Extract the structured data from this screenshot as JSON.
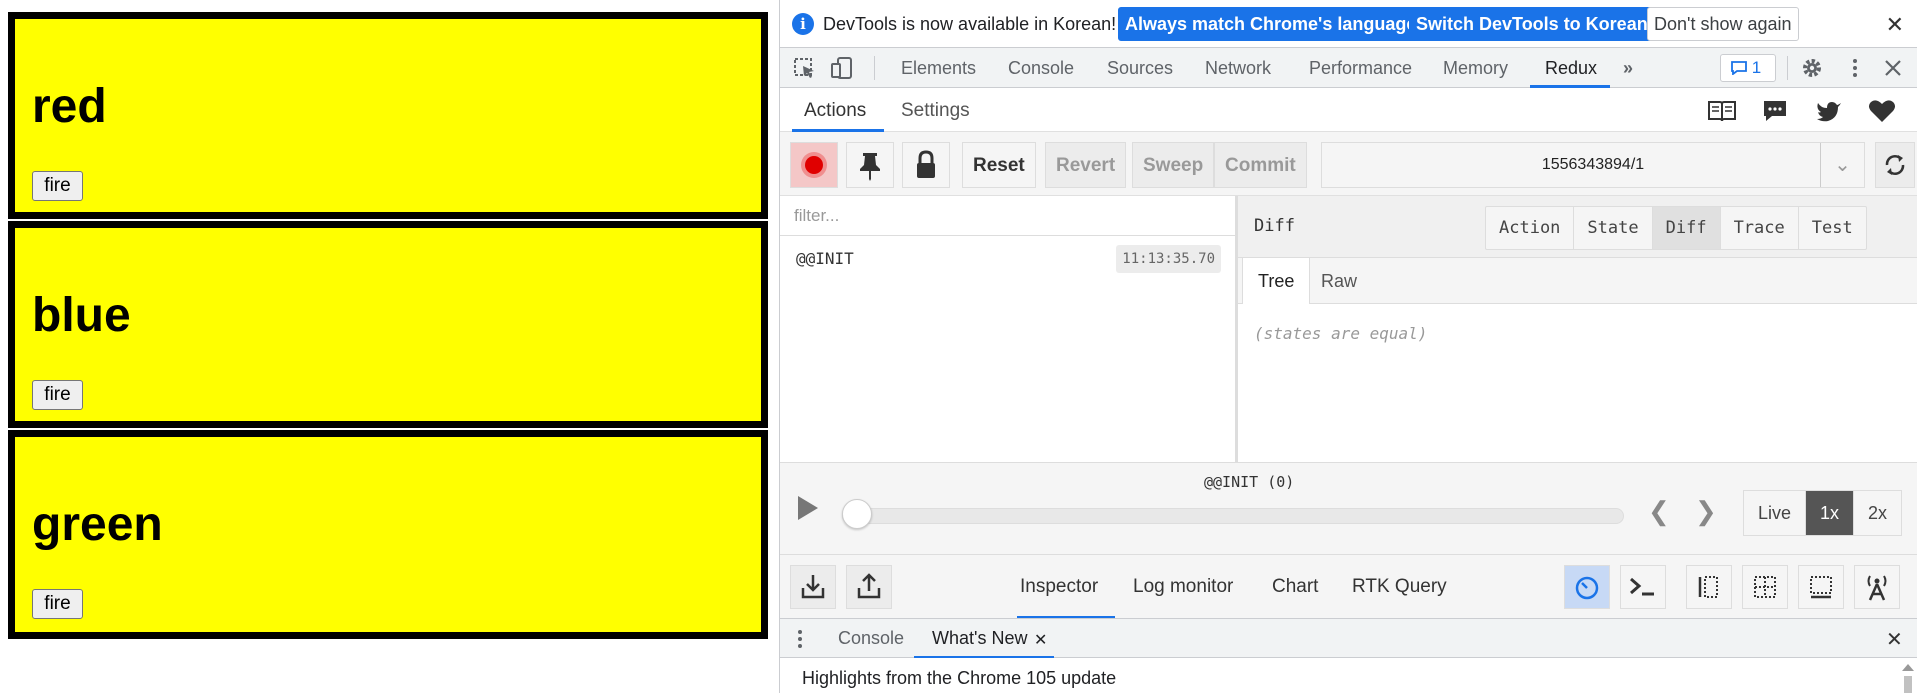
{
  "page": {
    "boxes": [
      {
        "heading": "red",
        "button": "fire"
      },
      {
        "heading": "blue",
        "button": "fire"
      },
      {
        "heading": "green",
        "button": "fire"
      }
    ]
  },
  "devtools": {
    "infobar": {
      "message": "DevTools is now available in Korean!",
      "btn_match": "Always match Chrome's language",
      "btn_switch": "Switch DevTools to Korean",
      "btn_dont_show": "Don't show again"
    },
    "tabs": [
      "Elements",
      "Console",
      "Sources",
      "Network",
      "Performance",
      "Memory",
      "Redux"
    ],
    "more_tabs_icon": "double-chevron-right-icon",
    "issues_count": "1",
    "redux": {
      "subtabs": [
        "Actions",
        "Settings"
      ],
      "controls": {
        "reset": "Reset",
        "revert": "Revert",
        "sweep": "Sweep",
        "commit": "Commit",
        "instance": "1556343894/1"
      },
      "filter_placeholder": "filter...",
      "actions": [
        {
          "name": "@@INIT",
          "time": "11:13:35.70"
        }
      ],
      "diff": {
        "title": "Diff",
        "modes": [
          "Action",
          "State",
          "Diff",
          "Trace",
          "Test"
        ],
        "active_mode": "Diff",
        "tree_tabs": [
          "Tree",
          "Raw"
        ],
        "message": "(states are equal)"
      },
      "slider": {
        "label": "@@INIT (0)",
        "position": 0,
        "speeds": [
          "Live",
          "1x",
          "2x"
        ],
        "active_speed": "1x"
      },
      "monitors": [
        "Inspector",
        "Log monitor",
        "Chart",
        "RTK Query"
      ],
      "active_monitor": "Inspector"
    },
    "drawer": {
      "tabs": [
        "Console",
        "What's New"
      ],
      "content": "Highlights from the Chrome 105 update"
    }
  }
}
